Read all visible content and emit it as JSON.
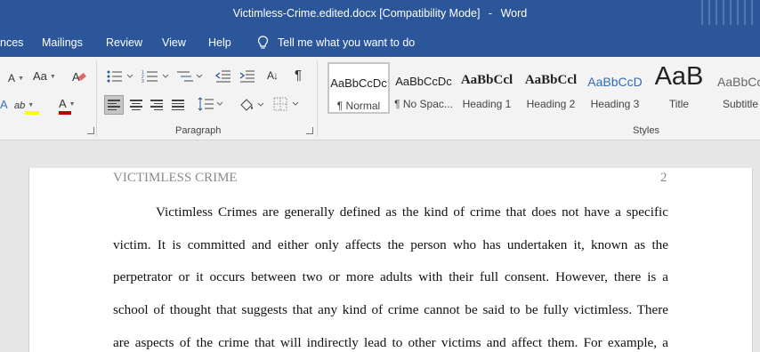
{
  "window": {
    "doc_name": "Victimless-Crime.edited.docx",
    "mode": "[Compatibility Mode]",
    "separator": "-",
    "app": "Word"
  },
  "tabs": [
    {
      "label": "nces"
    },
    {
      "label": "Mailings"
    },
    {
      "label": "Review"
    },
    {
      "label": "View"
    },
    {
      "label": "Help"
    }
  ],
  "tell_me": {
    "label": "Tell me what you want to do",
    "icon": "lightbulb-icon"
  },
  "ribbon": {
    "font_size_glyph": "A",
    "change_case_glyph": "Aa",
    "font_color_glyph": "A",
    "highlight_glyph": "ab",
    "pilcrow": "¶",
    "sort_glyph": "A↓",
    "paragraph_group_label": "Paragraph",
    "styles_group_label": "Styles",
    "highlight_color": "#ffff00",
    "font_color": "#c00000"
  },
  "styles": [
    {
      "sample": "AaBbCcDc",
      "name": "¶ Normal"
    },
    {
      "sample": "AaBbCcDc",
      "name": "¶ No Spac..."
    },
    {
      "sample": "AaBbCcl",
      "name": "Heading 1"
    },
    {
      "sample": "AaBbCcl",
      "name": "Heading 2"
    },
    {
      "sample": "AaBbCcD",
      "name": "Heading 3"
    },
    {
      "sample": "AaB",
      "name": "Title"
    },
    {
      "sample": "AaBbCcD",
      "name": "Subtitle"
    }
  ],
  "document": {
    "header_left": "VICTIMLESS CRIME",
    "page_number": "2",
    "lines": [
      "Victimless Crimes are generally defined as the kind of crime that does not have a specific",
      "victim. It is committed and either only affects the person who has undertaken it, known as the",
      "perpetrator or it occurs between two or more adults with their full consent. However, there is a",
      "school of thought that suggests that any kind of crime cannot be said to be fully victimless. There",
      "are aspects of the crime that will indirectly lead to other victims and affect them. For example, a"
    ]
  }
}
